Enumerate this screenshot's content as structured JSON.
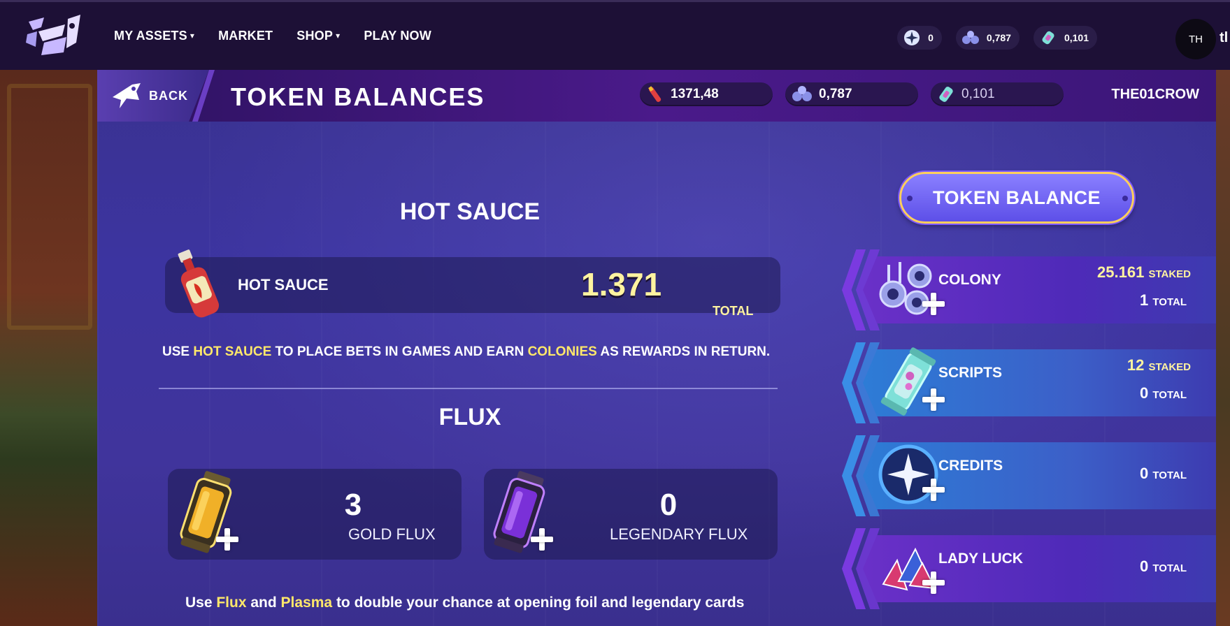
{
  "nav": {
    "links": [
      "MY ASSETS",
      "MARKET",
      "SHOP",
      "PLAY NOW"
    ],
    "balances": [
      "0",
      "0,787",
      "0,101"
    ],
    "avatar_initials": "TH",
    "username_truncated": "tl"
  },
  "header": {
    "back_label": "BACK",
    "title": "TOKEN BALANCES",
    "balances": [
      "1371,48",
      "0,787",
      "0,101"
    ],
    "username": "THE01CROW"
  },
  "hot_sauce": {
    "section_title": "HOT SAUCE",
    "label": "HOT SAUCE",
    "value": "1.371",
    "total_label": "TOTAL",
    "desc_1": "USE ",
    "desc_hl1": "HOT SAUCE",
    "desc_2": " TO PLACE BETS IN GAMES AND EARN ",
    "desc_hl2": "COLONIES",
    "desc_3": " AS REWARDS IN RETURN."
  },
  "flux": {
    "section_title": "FLUX",
    "gold_value": "3",
    "gold_label": "GOLD FLUX",
    "legendary_value": "0",
    "legendary_label": "LEGENDARY FLUX",
    "desc_1": "Use ",
    "desc_hl1": "Flux",
    "desc_2": " and ",
    "desc_hl2": "Plasma",
    "desc_3": " to double your chance at opening foil and legendary cards"
  },
  "token_balance": {
    "button_label": "TOKEN BALANCE",
    "rows": [
      {
        "name": "COLONY",
        "staked": "25.161",
        "staked_label": "STAKED",
        "total": "1",
        "total_label": "TOTAL"
      },
      {
        "name": "SCRIPTS",
        "staked": "12",
        "staked_label": "STAKED",
        "total": "0",
        "total_label": "TOTAL"
      },
      {
        "name": "CREDITS",
        "total": "0",
        "total_label": "TOTAL"
      },
      {
        "name": "LADY LUCK",
        "total": "0",
        "total_label": "TOTAL"
      }
    ]
  },
  "colors": {
    "accent_yellow": "#ffe86a",
    "purple_row": "#6a30c8",
    "blue_row": "#2d7cd6",
    "button": "#6f63f0"
  },
  "icons": [
    "logo",
    "chevron-down-icon",
    "credits-icon",
    "colony-icon",
    "scripts-icon",
    "hot-sauce-icon",
    "back-arrow-icon",
    "gold-flux-icon",
    "legendary-flux-icon",
    "lady-luck-icon",
    "plus-icon"
  ]
}
